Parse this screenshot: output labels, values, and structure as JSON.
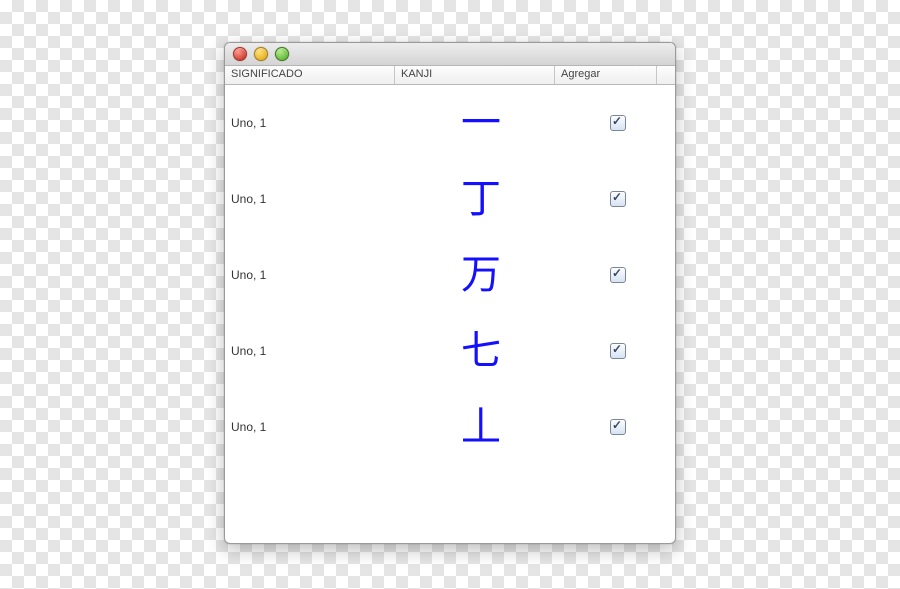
{
  "table": {
    "headers": {
      "significado": "SIGNIFICADO",
      "kanji": "KANJI",
      "agregar": "Agregar"
    },
    "rows": [
      {
        "significado": "Uno, 1",
        "kanji": "一",
        "agregar": true
      },
      {
        "significado": "Uno, 1",
        "kanji": "丁",
        "agregar": true
      },
      {
        "significado": "Uno, 1",
        "kanji": "万",
        "agregar": true
      },
      {
        "significado": "Uno, 1",
        "kanji": "七",
        "agregar": true
      },
      {
        "significado": "Uno, 1",
        "kanji": "丄",
        "agregar": true
      }
    ]
  }
}
